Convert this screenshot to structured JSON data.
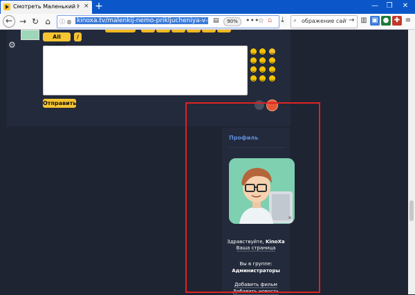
{
  "browser": {
    "tab_title": "Смотреть Маленький Немо: Пр",
    "tab_close": "×",
    "new_tab": "+",
    "url": "kinoxa.tv/malenkij-nemo-prikljucheniya-v-strane",
    "zoom": "90%",
    "search_text": "ображение сайта",
    "window_controls": [
      "—",
      "❐",
      "✕"
    ]
  },
  "comments": {
    "toolbar_buttons": [
      "All codes",
      "/"
    ],
    "submit_label": "Отправить",
    "textarea_value": ""
  },
  "sidebar": {
    "title": "Профиль",
    "greeting_prefix": "Здравствуйте, ",
    "username": "KinoXa",
    "your_page": "Ваша страница",
    "group_label": "Вы в группе:",
    "group_name": "Администраторы",
    "add_film": "Добавить фильм",
    "add_news": "Добавить новость"
  },
  "colors": {
    "background": "#1f2432",
    "panel": "#232a3b",
    "accent_yellow": "#f7c531",
    "highlight_red": "#e02222",
    "profile_title": "#5e8dd8"
  }
}
